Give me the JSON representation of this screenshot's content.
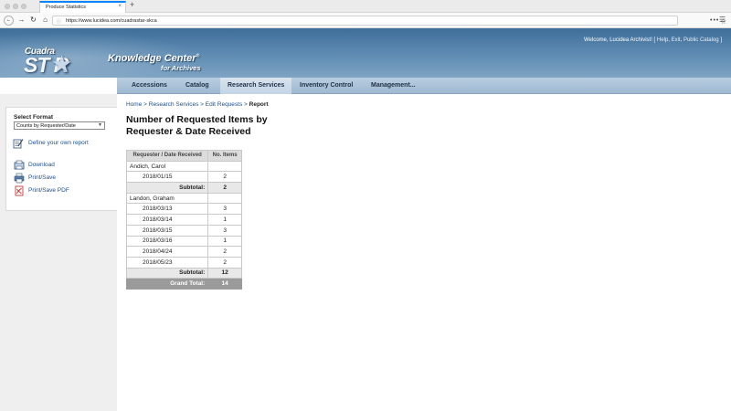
{
  "browser": {
    "tab_title": "Produce Statistics",
    "tab_close": "×",
    "new_tab": "+",
    "url": "https://www.lucidea.com/cuadrastar-skca",
    "more": "•••",
    "star": "☆",
    "menu": "☰"
  },
  "header": {
    "logo_top": "Cuadra",
    "logo_bottom": "ST R",
    "logo_mark": "★",
    "kc_title": "Knowledge Center",
    "kc_reg": "®",
    "kc_sub": "for Archives",
    "welcome_prefix": "Welcome, Lucidea Archivist! [",
    "help": "Help",
    "exit": "Exit",
    "public_catalog": "Public Catalog",
    "welcome_suffix": "]"
  },
  "nav": {
    "items": [
      {
        "label": "Accessions"
      },
      {
        "label": "Catalog"
      },
      {
        "label": "Research Services"
      },
      {
        "label": "Inventory Control"
      },
      {
        "label": "Management..."
      }
    ]
  },
  "sidebar": {
    "select_label": "Select Format",
    "select_value": "Counts by Requester/Date",
    "define_link": "Define your own report",
    "download": "Download",
    "print_save": "Print/Save",
    "print_pdf": "Print/Save PDF"
  },
  "breadcrumb": {
    "home": "Home",
    "research": "Research Services",
    "edit": "Edit Requests",
    "current": "Report",
    "sep": ">"
  },
  "page": {
    "title_line1": "Number of Requested Items by",
    "title_line2": "Requester & Date Received"
  },
  "table": {
    "headers": [
      "Requester / Date Received",
      "No. Items"
    ],
    "rows": [
      {
        "type": "group",
        "label": "Andich, Carol",
        "value": ""
      },
      {
        "type": "item",
        "label": "2018/01/15",
        "value": "2"
      },
      {
        "type": "subtotal",
        "label": "Subtotal:",
        "value": "2"
      },
      {
        "type": "group",
        "label": "Landon, Graham",
        "value": ""
      },
      {
        "type": "item",
        "label": "2018/03/13",
        "value": "3"
      },
      {
        "type": "item",
        "label": "2018/03/14",
        "value": "1"
      },
      {
        "type": "item",
        "label": "2018/03/15",
        "value": "3"
      },
      {
        "type": "item",
        "label": "2018/03/16",
        "value": "1"
      },
      {
        "type": "item",
        "label": "2018/04/24",
        "value": "2"
      },
      {
        "type": "item",
        "label": "2018/05/23",
        "value": "2"
      },
      {
        "type": "subtotal",
        "label": "Subtotal:",
        "value": "12"
      },
      {
        "type": "grand",
        "label": "Grand Total:",
        "value": "14"
      }
    ]
  }
}
